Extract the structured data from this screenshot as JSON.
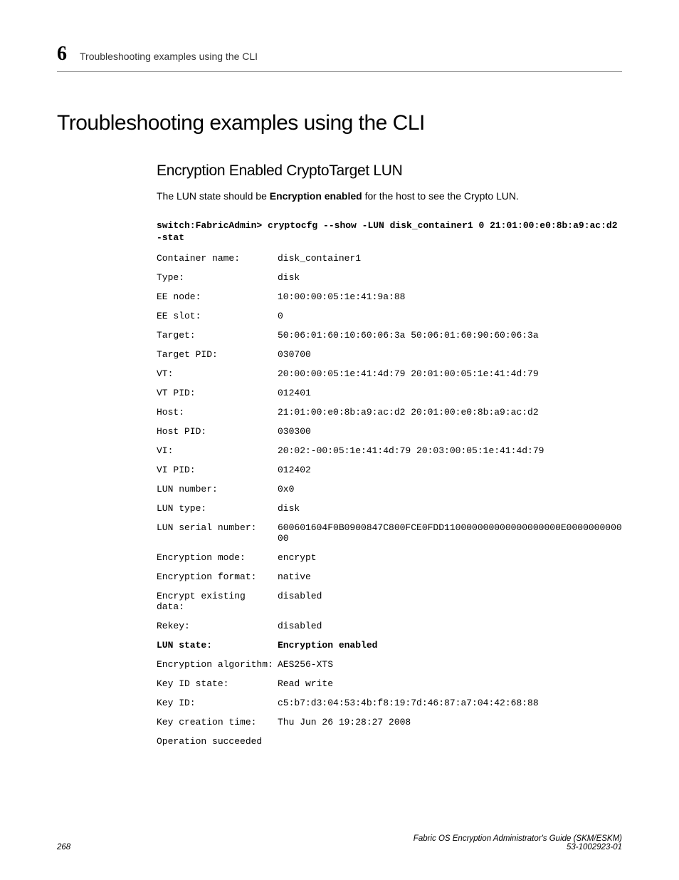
{
  "header": {
    "chapter": "6",
    "breadcrumb": "Troubleshooting examples using the CLI"
  },
  "main_heading": "Troubleshooting examples using the CLI",
  "sub_heading": "Encryption Enabled CryptoTarget LUN",
  "intro_pre": "The LUN state should be ",
  "intro_bold": "Encryption enabled",
  "intro_post": " for the host to see the Crypto LUN.",
  "command": "switch:FabricAdmin> cryptocfg --show -LUN disk_container1 0 21:01:00:e0:8b:a9:ac:d2 -stat",
  "kv": [
    {
      "k": "Container name:",
      "v": "disk_container1",
      "bold": false
    },
    {
      "k": "Type:",
      "v": "disk",
      "bold": false
    },
    {
      "k": "EE node:",
      "v": "10:00:00:05:1e:41:9a:88",
      "bold": false
    },
    {
      "k": "EE slot:",
      "v": "0",
      "bold": false
    },
    {
      "k": "Target:",
      "v": "50:06:01:60:10:60:06:3a 50:06:01:60:90:60:06:3a",
      "bold": false
    },
    {
      "k": "Target PID:",
      "v": "030700",
      "bold": false
    },
    {
      "k": "VT:",
      "v": "20:00:00:05:1e:41:4d:79 20:01:00:05:1e:41:4d:79",
      "bold": false
    },
    {
      "k": "VT PID:",
      "v": "012401",
      "bold": false
    },
    {
      "k": "Host:",
      "v": "21:01:00:e0:8b:a9:ac:d2 20:01:00:e0:8b:a9:ac:d2",
      "bold": false
    },
    {
      "k": "Host PID:",
      "v": "030300",
      "bold": false
    },
    {
      "k": "VI:",
      "v": "20:02:-00:05:1e:41:4d:79 20:03:00:05:1e:41:4d:79",
      "bold": false
    },
    {
      "k": "VI PID:",
      "v": "012402",
      "bold": false
    },
    {
      "k": "LUN number:",
      "v": "0x0",
      "bold": false
    },
    {
      "k": "LUN type:",
      "v": "disk",
      "bold": false
    },
    {
      "k": "LUN serial number:",
      "v": "600601604F0B0900847C800FCE0FDD110000000000000000000E000000000000",
      "bold": false
    },
    {
      "k": "Encryption mode:",
      "v": "encrypt",
      "bold": false
    },
    {
      "k": "Encryption format:",
      "v": "native",
      "bold": false
    },
    {
      "k": "Encrypt existing data:",
      "v": "disabled",
      "bold": false
    },
    {
      "k": "Rekey:",
      "v": "disabled",
      "bold": false
    },
    {
      "k": "LUN state:",
      "v": "Encryption enabled",
      "bold": true
    },
    {
      "k": "Encryption algorithm:",
      "v": "AES256-XTS",
      "bold": false
    },
    {
      "k": "Key ID state:",
      "v": "Read write",
      "bold": false
    },
    {
      "k": "Key ID:",
      "v": "c5:b7:d3:04:53:4b:f8:19:7d:46:87:a7:04:42:68:88",
      "bold": false
    },
    {
      "k": "Key creation time:",
      "v": "Thu Jun 26 19:28:27 2008",
      "bold": false
    }
  ],
  "op_succeeded": "Operation succeeded",
  "footer": {
    "page_num": "268",
    "doc_title": "Fabric OS Encryption Administrator's Guide (SKM/ESKM)",
    "doc_id": "53-1002923-01"
  }
}
